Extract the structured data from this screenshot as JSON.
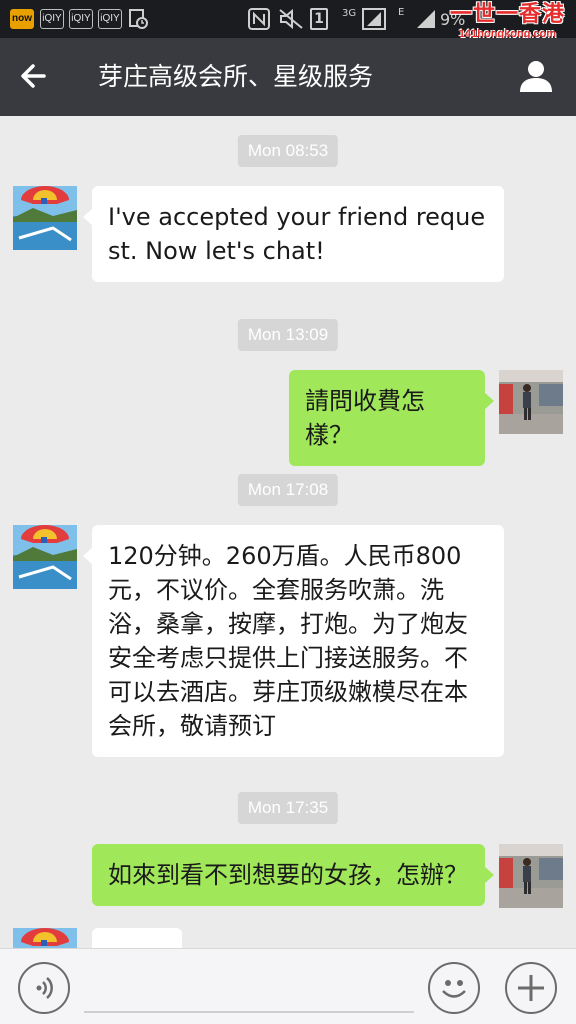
{
  "status_bar": {
    "apps": [
      "now",
      "iQIY",
      "iQIY",
      "iQIY"
    ],
    "network_label": "3G",
    "network_label_2": "E",
    "sim_slot": "1",
    "battery": "9%",
    "icons": [
      "nfc-icon",
      "mute-icon",
      "signal-icon",
      "battery-icon",
      "clock-icon"
    ]
  },
  "watermark": {
    "title": "一世一香港",
    "url": "141hongkong.com"
  },
  "nav": {
    "title": "芽庄高级会所、星级服务",
    "back_icon": "arrow-left-icon",
    "profile_icon": "person-icon",
    "bg_color": "#393a3f"
  },
  "messages": [
    {
      "kind": "time",
      "text": "Mon 08:53"
    },
    {
      "kind": "in",
      "text": "I've accepted your friend request. Now let's chat!"
    },
    {
      "kind": "time",
      "text": "Mon 13:09"
    },
    {
      "kind": "out",
      "text": "請問收費怎樣？"
    },
    {
      "kind": "time",
      "text": "Mon 17:08"
    },
    {
      "kind": "in",
      "text": "120分钟。260万盾。人民币800元，不议价。全套服务吹萧。洗浴，桑拿，按摩，打炮。为了炮友安全考虑只提供上门接送服务。不可以去酒店。芽庄顶级嫩模尽在本会所，敬请预订"
    },
    {
      "kind": "time",
      "text": "Mon 17:35"
    },
    {
      "kind": "out",
      "text": "如來到看不到想要的女孩，怎辦？"
    },
    {
      "kind": "in",
      "text": ""
    }
  ],
  "input_bar": {
    "voice_icon": "voice-icon",
    "emoji_icon": "emoji-icon",
    "add_icon": "plus-icon",
    "value": ""
  },
  "colors": {
    "chat_bg": "#ebebeb",
    "outgoing_bubble": "#a0e75a",
    "incoming_bubble": "#ffffff",
    "timestamp_bg": "#d6d6d6"
  }
}
